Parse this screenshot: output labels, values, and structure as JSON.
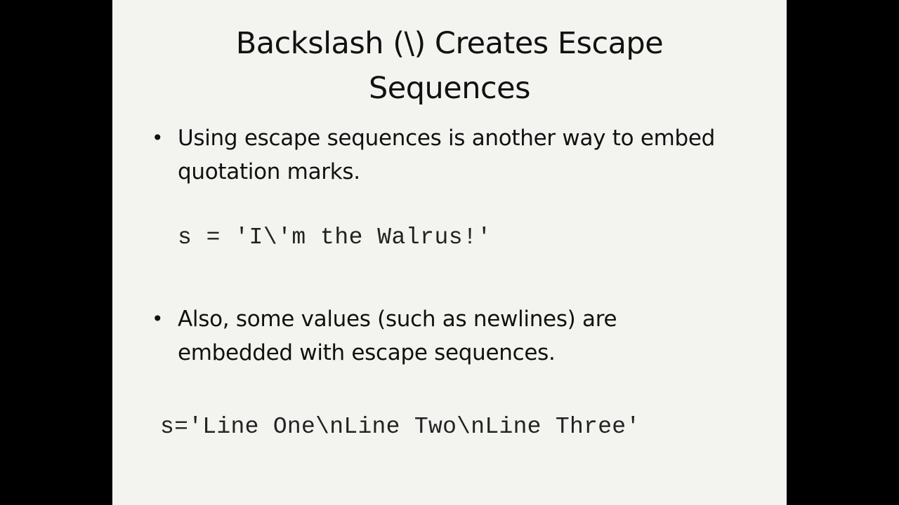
{
  "slide": {
    "title_line1": "Backslash (\\) Creates Escape",
    "title_line2": "Sequences",
    "bullets": [
      {
        "marker": "•",
        "line1": "Using escape sequences is another way to embed",
        "line2": "quotation marks."
      },
      {
        "marker": "•",
        "line1": "Also, some values (such as newlines) are",
        "line2": "embedded with escape sequences."
      }
    ],
    "code_example_1": "s = 'I\\'m the Walrus!'",
    "code_example_2": "s='Line One\\nLine Two\\nLine Three'"
  },
  "colors": {
    "slide_background": "#f3f4f0",
    "letterbox": "#000000",
    "text": "#111111"
  }
}
